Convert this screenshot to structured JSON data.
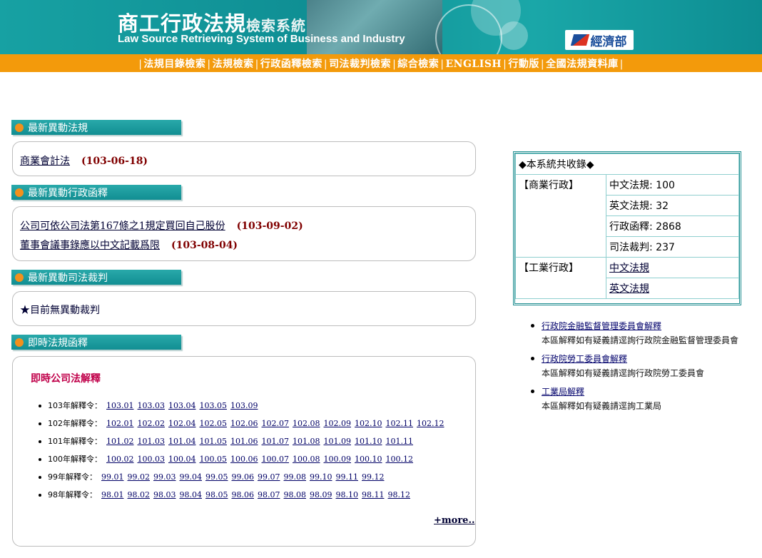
{
  "banner": {
    "title_zh": "商工行政法規",
    "title_zh_small": "檢索系統",
    "title_en": "Law Source Retrieving System of Business and Industry",
    "logo_text": "經濟部"
  },
  "nav": {
    "items": [
      "法規目錄檢索",
      "法規檢索",
      "行政函釋檢索",
      "司法裁判檢索",
      "綜合檢索",
      "ENGLISH",
      "行動版",
      "全國法規資料庫"
    ],
    "separator": "|"
  },
  "sections": {
    "laws": {
      "title": "最新異動法規",
      "items": [
        {
          "text": "商業會計法",
          "date": "(103-06-18)"
        }
      ]
    },
    "admin": {
      "title": "最新異動行政函釋",
      "items": [
        {
          "text": "公司可依公司法第167條之1規定買回自己股份",
          "date": "(103-09-02)"
        },
        {
          "text": "董事會議事錄應以中文記載爲限",
          "date": "(103-08-04)"
        }
      ]
    },
    "judicial": {
      "title": "最新異動司法裁判",
      "text": "★目前無異動裁判"
    },
    "instant": {
      "title": "即時法規函釋",
      "subtitle": "即時公司法解釋",
      "rows": [
        {
          "label": "103年解釋令：",
          "links": [
            "103.01",
            "103.03",
            "103.04",
            "103.05",
            "103.09"
          ]
        },
        {
          "label": "102年解釋令：",
          "links": [
            "102.01",
            "102.02",
            "102.04",
            "102.05",
            "102.06",
            "102.07",
            "102.08",
            "102.09",
            "102.10",
            "102.11",
            "102.12"
          ]
        },
        {
          "label": "101年解釋令：",
          "links": [
            "101.02",
            "101.03",
            "101.04",
            "101.05",
            "101.06",
            "101.07",
            "101.08",
            "101.09",
            "101.10",
            "101.11"
          ]
        },
        {
          "label": "100年解釋令：",
          "links": [
            "100.02",
            "100.03",
            "100.04",
            "100.05",
            "100.06",
            "100.07",
            "100.08",
            "100.09",
            "100.10",
            "100.12"
          ]
        },
        {
          "label": "99年解釋令：",
          "links": [
            "99.01",
            "99.02",
            "99.03",
            "99.04",
            "99.05",
            "99.06",
            "99.07",
            "99.08",
            "99.10",
            "99.11",
            "99.12"
          ]
        },
        {
          "label": "98年解釋令：",
          "links": [
            "98.01",
            "98.02",
            "98.03",
            "98.04",
            "98.05",
            "98.06",
            "98.07",
            "98.08",
            "98.09",
            "98.10",
            "98.11",
            "98.12"
          ]
        }
      ],
      "more": "+more.."
    }
  },
  "stats": {
    "header": "◆本系統共收錄◆",
    "commerce_label": "【商業行政】",
    "commerce_rows": [
      "中文法規: 100",
      "英文法規: 32",
      "行政函釋: 2868",
      "司法裁判: 237"
    ],
    "industry_label": "【工業行政】",
    "industry_links": [
      "中文法規",
      "英文法規"
    ]
  },
  "notes": [
    {
      "link": "行政院金融監督管理委員會解釋",
      "desc": "本區解釋如有疑義請逕詢行政院金融監督管理委員會"
    },
    {
      "link": "行政院勞工委員會解釋",
      "desc": "本區解釋如有疑義請逕詢行政院勞工委員會"
    },
    {
      "link": "工業局解釋",
      "desc": "本區解釋如有疑義請逕詢工業局"
    }
  ],
  "colors": {
    "teal": "#118e92",
    "orange": "#f39a0b",
    "date": "#800000",
    "subtitle": "#c0004a"
  }
}
